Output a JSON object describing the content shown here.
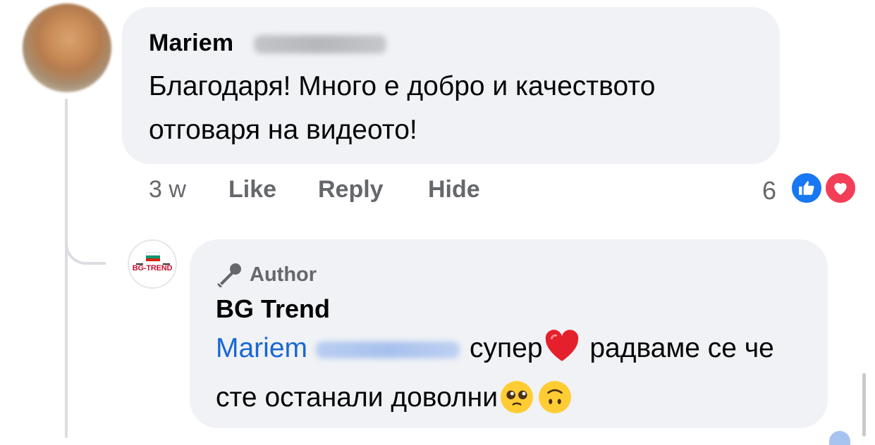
{
  "comment": {
    "author_first": "Mariem",
    "text": "Благодаря! Много е добро и качеството отговаря на видеото!",
    "time": "3 w",
    "actions": {
      "like": "Like",
      "reply": "Reply",
      "hide": "Hide"
    },
    "reaction_count": "6",
    "reactions": [
      "like-icon",
      "love-icon"
    ]
  },
  "reply": {
    "badge_label": "Author",
    "badge_icon": "microphone-icon",
    "author": "BG Trend",
    "logo_text": "BG-TREND",
    "mention_first": "Mariem",
    "text_part1": "супер",
    "text_part2": "радваме се че сте останали доволни",
    "emojis": [
      "red-heart",
      "pleading-face",
      "upside-down-face"
    ]
  },
  "colors": {
    "bubble_bg": "#f0f2f5",
    "meta_text": "#65676b",
    "mention": "#1a67d2",
    "like_blue": "#1877f2",
    "love_red": "#f33e58",
    "logo_red": "#c8102e"
  }
}
